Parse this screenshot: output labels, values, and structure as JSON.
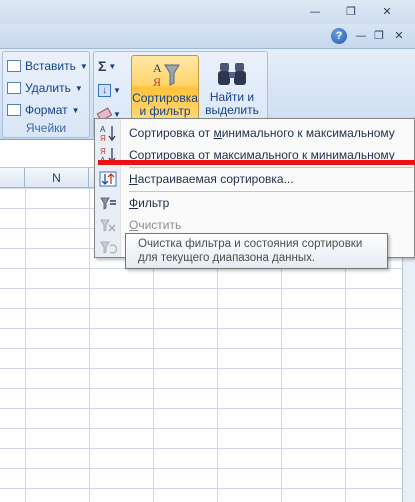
{
  "ribbon": {
    "cells_group": {
      "insert_label": "Вставить",
      "delete_label": "Удалить",
      "format_label": "Формат",
      "group_label": "Ячейки"
    },
    "editing_group": {
      "sort_filter_line1": "Сортировка",
      "sort_filter_line2": "и фильтр",
      "find_line1": "Найти и",
      "find_line2": "выделить"
    }
  },
  "sheet": {
    "column_header": "N"
  },
  "sort_menu": {
    "items": [
      {
        "label": "Сортировка от минимального к максимальному",
        "pre": "Сортировка от ",
        "accel": "м",
        "post": "инимального к максимальному",
        "icon": "sort-ascending-icon",
        "enabled": true
      },
      {
        "label": "Сортировка от максимального к минимальному",
        "pre": "Сортировка от ",
        "accel": "м",
        "post": "аксимального к минимальному",
        "icon": "sort-descending-icon",
        "enabled": true
      },
      {
        "label": "Настраиваемая сортировка...",
        "pre": "",
        "accel": "Н",
        "post": "астраиваемая сортировка...",
        "icon": "custom-sort-icon",
        "enabled": true
      },
      {
        "label": "Фильтр",
        "pre": "",
        "accel": "Ф",
        "post": "ильтр",
        "icon": "filter-icon",
        "enabled": true
      },
      {
        "label": "Очистить",
        "pre": "",
        "accel": "О",
        "post": "чистить",
        "icon": "clear-filter-icon",
        "enabled": false
      },
      {
        "label": "",
        "icon": "reapply-filter-icon",
        "enabled": false
      }
    ]
  },
  "tooltip": {
    "line1": "Очистка фильтра и состояния сортировки",
    "line2": "для текущего диапазона данных."
  },
  "colors": {
    "highlight_button": "#ffd46a",
    "annotation_line": "#ee1111",
    "ribbon_text": "#15428b"
  }
}
